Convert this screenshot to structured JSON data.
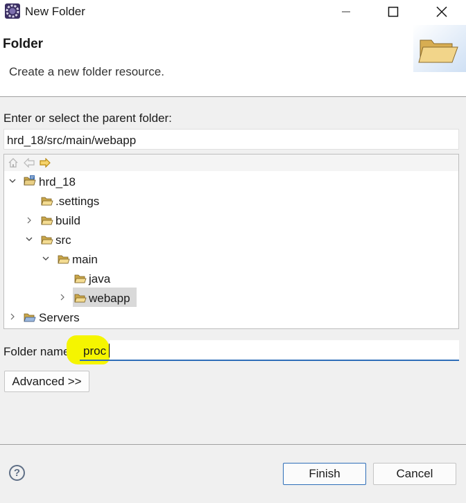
{
  "window": {
    "title": "New Folder",
    "icon": "eclipse-gear-icon"
  },
  "header": {
    "title": "Folder",
    "description": "Create a new folder resource.",
    "banner_icon": "open-folder-icon"
  },
  "parent": {
    "label": "Enter or select the parent folder:",
    "value": "hrd_18/src/main/webapp"
  },
  "tree": {
    "toolbar": [
      "home-icon",
      "back-arrow-icon",
      "forward-arrow-icon"
    ],
    "nodes": [
      {
        "label": "hrd_18",
        "expanded": true,
        "icon": "project-icon"
      },
      {
        "label": ".settings",
        "expanded": null,
        "icon": "folder-icon"
      },
      {
        "label": "build",
        "expanded": false,
        "icon": "folder-icon"
      },
      {
        "label": "src",
        "expanded": true,
        "icon": "folder-icon"
      },
      {
        "label": "main",
        "expanded": true,
        "icon": "folder-icon"
      },
      {
        "label": "java",
        "expanded": null,
        "icon": "folder-icon"
      },
      {
        "label": "webapp",
        "expanded": false,
        "icon": "folder-icon",
        "selected": true
      },
      {
        "label": "Servers",
        "expanded": false,
        "icon": "folder-icon"
      }
    ]
  },
  "folder_name": {
    "label": "Folder name:",
    "value": "proc",
    "highlight_color": "#f5f500"
  },
  "buttons": {
    "advanced": "Advanced >>",
    "finish": "Finish",
    "cancel": "Cancel",
    "help": "?"
  },
  "colors": {
    "accent": "#2d6db8",
    "selection": "#d9d9d9",
    "folder": "#e8b84a"
  }
}
